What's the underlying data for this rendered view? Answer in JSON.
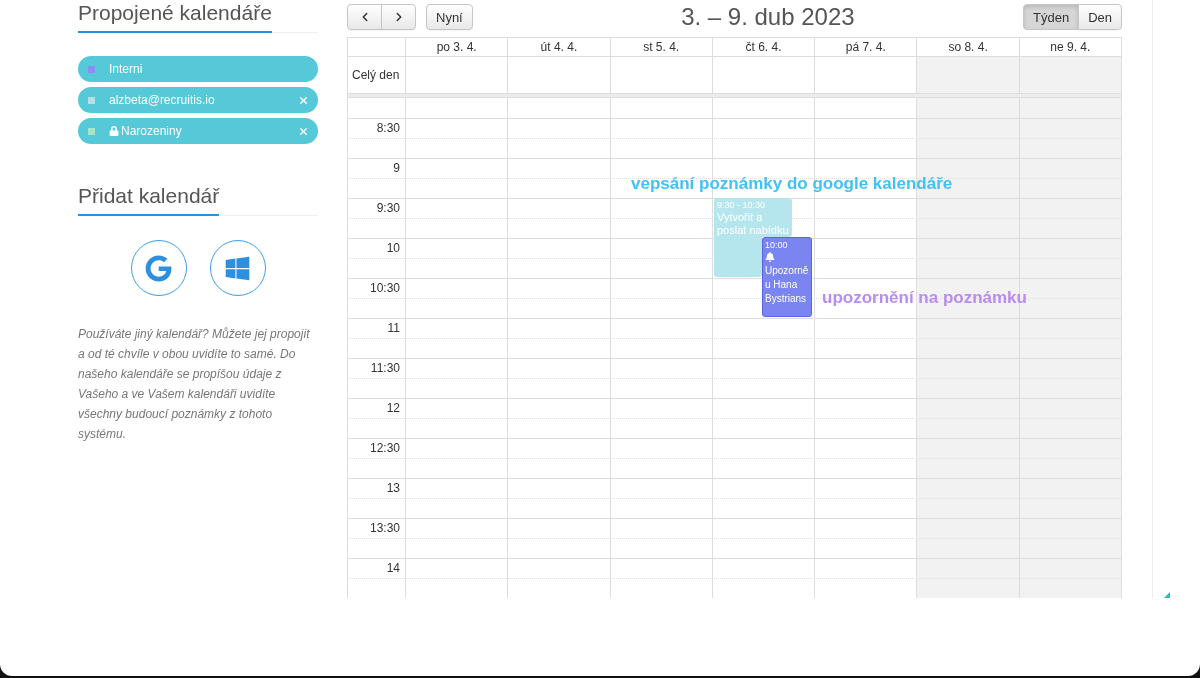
{
  "sidebar": {
    "linked_calendars": {
      "title": "Propojené kalendáře",
      "items": [
        {
          "name": "Interni",
          "color": "#8a8df2",
          "locked": false,
          "removable": false
        },
        {
          "name": "alzbeta@recruitis.io",
          "color": "#b4dfe6",
          "locked": false,
          "removable": true
        },
        {
          "name": "Narozeniny",
          "color": "#a6e6c6",
          "locked": true,
          "removable": true
        }
      ]
    },
    "add_calendar": {
      "title": "Přidat kalendář",
      "description": "Používáte jiný kalendář? Můžete jej propojit a od té chvíle v obou uvidíte to samé. Do našeho kalendáře se propíšou údaje z Vašeho a ve Vašem kalendáři uvidíte všechny budoucí poznámky z tohoto systému."
    }
  },
  "calendar": {
    "toolbar": {
      "today_button": "Nyní",
      "title": "3. – 9. dub 2023",
      "views": [
        {
          "label": "Týden",
          "selected": true
        },
        {
          "label": "Den",
          "selected": false
        }
      ]
    },
    "all_day_label": "Celý den",
    "days": [
      {
        "label": "po 3. 4.",
        "weekend": false
      },
      {
        "label": "út 4. 4.",
        "weekend": false
      },
      {
        "label": "st 5. 4.",
        "weekend": false
      },
      {
        "label": "čt 6. 4.",
        "weekend": false
      },
      {
        "label": "pá 7. 4.",
        "weekend": false
      },
      {
        "label": "so 8. 4.",
        "weekend": true
      },
      {
        "label": "ne 9. 4.",
        "weekend": true
      }
    ],
    "time_labels": [
      "8:30",
      "9",
      "9:30",
      "10",
      "10:30",
      "11",
      "11:30",
      "12",
      "12:30",
      "13",
      "13:30",
      "14"
    ],
    "events": [
      {
        "kind": "note",
        "time": "9:30 - 10:30",
        "title": "Vytvořit a poslat nabídku",
        "color": "#b5e6ed"
      },
      {
        "kind": "reminder",
        "time": "10:00",
        "title": "Upozorně u Hana Bystrians",
        "color": "#7b85f2"
      }
    ]
  },
  "annotations": [
    {
      "text": "vepsání poznámky do google kalendáře",
      "color": "#3fc3f5"
    },
    {
      "text": "upozornění na poznámku",
      "color": "#b88cf0"
    }
  ]
}
